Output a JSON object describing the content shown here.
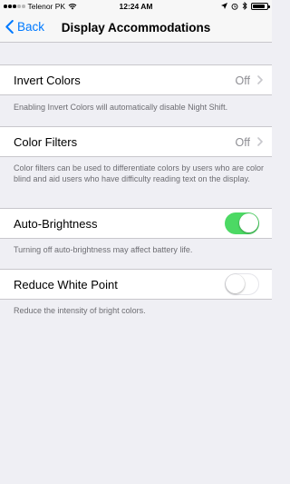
{
  "status_bar": {
    "carrier": "Telenor PK",
    "time": "12:24 AM",
    "battery_level": 0.85
  },
  "nav": {
    "back_label": "Back",
    "title": "Display Accommodations"
  },
  "rows": {
    "invert_colors": {
      "label": "Invert Colors",
      "value": "Off",
      "footer": "Enabling Invert Colors will automatically disable Night Shift."
    },
    "color_filters": {
      "label": "Color Filters",
      "value": "Off",
      "footer": "Color filters can be used to differentiate colors by users who are color blind and aid users who have difficulty reading text on the display."
    },
    "auto_brightness": {
      "label": "Auto-Brightness",
      "state": "on",
      "footer": "Turning off auto-brightness may affect battery life."
    },
    "reduce_white_point": {
      "label": "Reduce White Point",
      "state": "off",
      "footer": "Reduce the intensity of bright colors."
    }
  },
  "colors": {
    "accent": "#007aff",
    "toggle_on": "#4cd964",
    "background": "#efeff4",
    "secondary_text": "#8e8e93",
    "footer_text": "#6d6d72"
  },
  "icons": {
    "back": "chevron-left-icon",
    "disclosure": "chevron-right-icon",
    "wifi": "wifi-icon",
    "location": "location-arrow-icon",
    "alarm": "alarm-icon",
    "bluetooth": "bluetooth-icon",
    "battery": "battery-icon"
  }
}
